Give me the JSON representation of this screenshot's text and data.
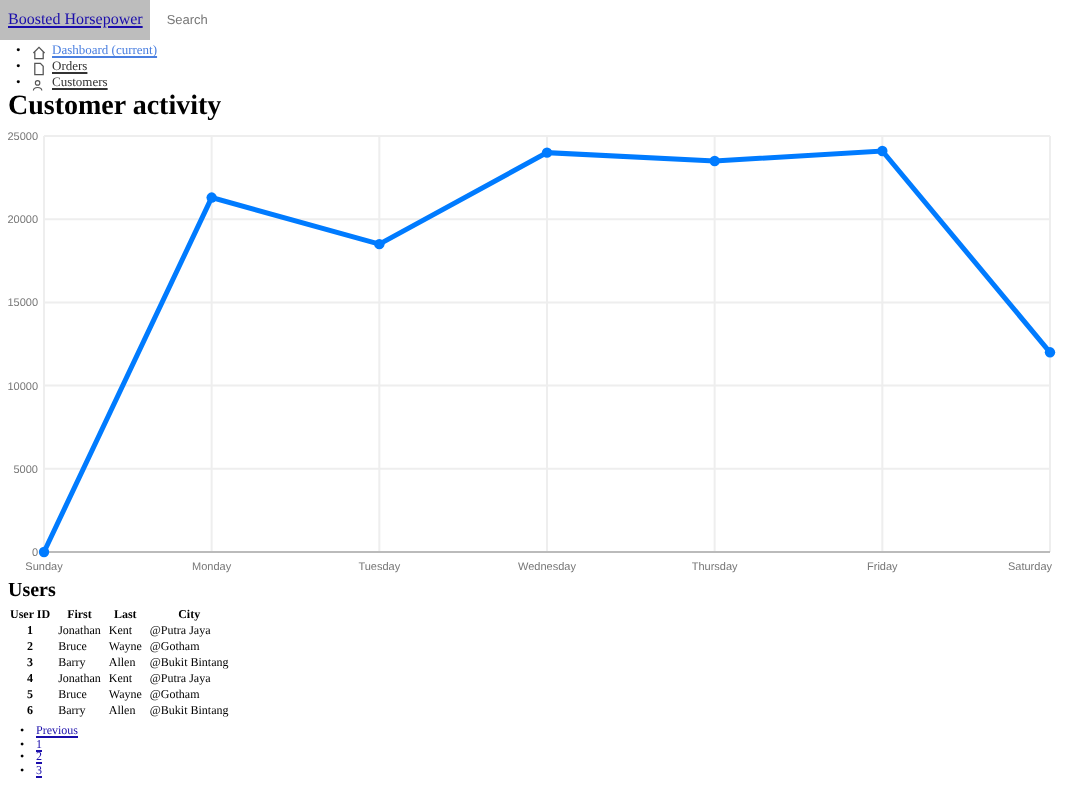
{
  "navbar": {
    "brand": "Boosted Horsepower",
    "search": {
      "placeholder": "Search"
    }
  },
  "sidebar": {
    "marker": "•",
    "items": [
      {
        "label": "Dashboard (current)",
        "kind": "home",
        "selected": true
      },
      {
        "label": "Orders",
        "kind": "file",
        "selected": false
      },
      {
        "label": "Customers",
        "kind": "users",
        "selected": false
      }
    ]
  },
  "title": "Customer activity",
  "chart": {
    "chart_data": {
      "type": "line",
      "categories": [
        "Sunday",
        "Monday",
        "Tuesday",
        "Wednesday",
        "Thursday",
        "Friday",
        "Saturday"
      ],
      "grid": true,
      "series": [
        {
          "color": "#007bff",
          "marker": true,
          "values": [
            0,
            21300,
            18500,
            24000,
            23500,
            24100,
            12000
          ]
        }
      ],
      "ylim": [
        0,
        25000
      ],
      "yticks": [
        0,
        5000,
        10000,
        15000,
        20000,
        25000
      ]
    }
  },
  "users": {
    "title": "Users",
    "columns": [
      "User ID",
      "First",
      "Last",
      "City"
    ],
    "rows": [
      [
        "1",
        "Jonathan",
        "Kent",
        "@Putra Jaya"
      ],
      [
        "2",
        "Bruce",
        "Wayne",
        "@Gotham"
      ],
      [
        "3",
        "Barry",
        "Allen",
        "@Bukit Bintang"
      ],
      [
        "4",
        "Jonathan",
        "Kent",
        "@Putra Jaya"
      ],
      [
        "5",
        "Bruce",
        "Wayne",
        "@Gotham"
      ],
      [
        "6",
        "Barry",
        "Allen",
        "@Bukit Bintang"
      ]
    ]
  },
  "pagination": {
    "marker": "•",
    "links": [
      "Previous",
      "1",
      "2",
      "3"
    ]
  }
}
